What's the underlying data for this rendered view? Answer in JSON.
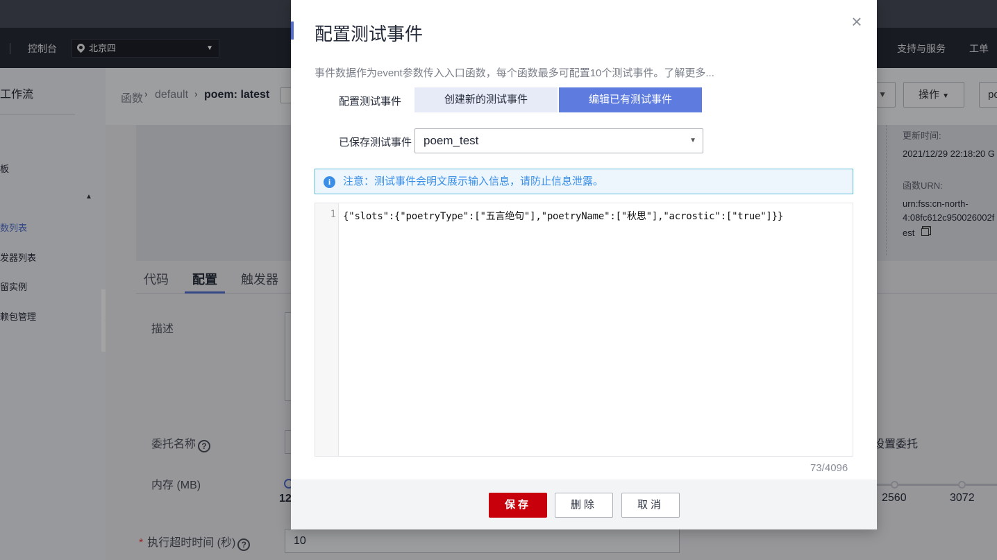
{
  "topbar": {
    "console": "控制台",
    "region": "北京四",
    "support": "支持与服务",
    "ticket": "工单"
  },
  "sidebar": {
    "title": "工作流",
    "items": [
      "板",
      "数列表",
      "发器列表",
      "留实例",
      "赖包管理"
    ]
  },
  "breadcrumb": {
    "root": "函数",
    "group": "default",
    "current": "poem: latest"
  },
  "header_actions": {
    "operations": "操作",
    "right_partial": "po"
  },
  "info_panel": {
    "updated_label": "更新时间:",
    "updated_value": "2021/12/29 22:18:20 G",
    "urn_label": "函数URN:",
    "urn_line1": "urn:fss:cn-north-",
    "urn_line2": "4:08fc612c950026002f",
    "urn_line3": "est"
  },
  "tabs": [
    "代码",
    "配置",
    "触发器"
  ],
  "config_form": {
    "description_label": "描述",
    "agency_label": "委托名称",
    "memory_label": "内存 (MB)",
    "memory_partial": "12",
    "timeout_label": "执行超时时间 (秒)",
    "timeout_value": "10",
    "memory_ticks": [
      "2560",
      "3072"
    ],
    "agency_right": "设置委托"
  },
  "modal": {
    "title": "配置测试事件",
    "description": "事件数据作为event参数传入入口函数，每个函数最多可配置10个测试事件。了解更多...",
    "config_label": "配置测试事件",
    "option_create": "创建新的测试事件",
    "option_edit": "编辑已有测试事件",
    "saved_label": "已保存测试事件",
    "saved_value": "poem_test",
    "notice": "注意：测试事件会明文展示输入信息，请防止信息泄露。",
    "editor": {
      "line_number": "1",
      "code": "{\"slots\":{\"poetryType\":[\"五言绝句\"],\"poetryName\":[\"秋思\"],\"acrostic\":[\"true\"]}}"
    },
    "char_count": "73/4096",
    "buttons": {
      "save": "保存",
      "delete": "删除",
      "cancel": "取消"
    }
  },
  "colors": {
    "accent": "#526ecc",
    "primary_button": "#c7000b",
    "segment_active": "#5e7ce0",
    "notice_text": "#3a8ee6"
  }
}
